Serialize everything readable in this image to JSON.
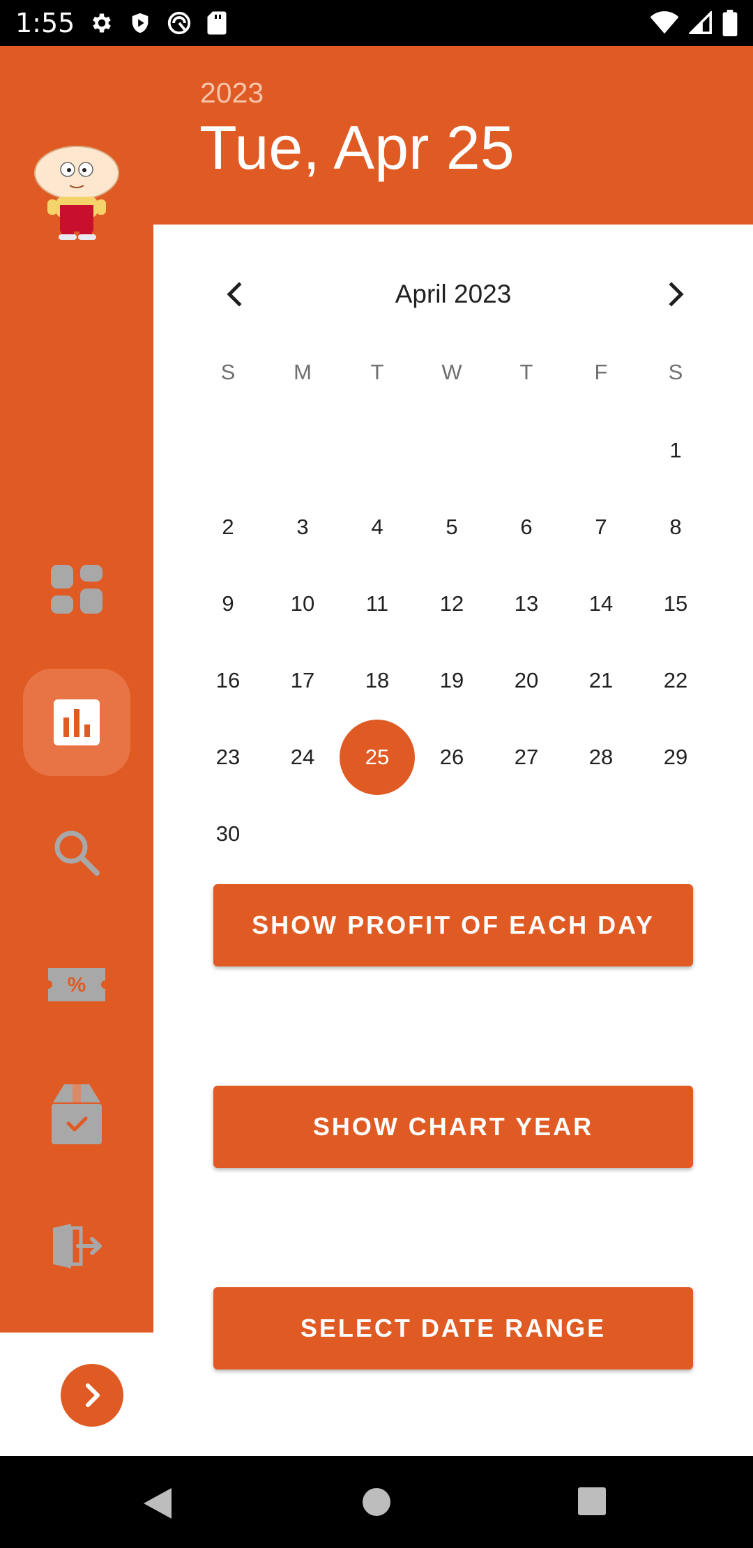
{
  "status_bar": {
    "time": "1:55",
    "left_icons": [
      "settings-icon",
      "shield-play-icon",
      "vpn-icon",
      "sd-card-icon"
    ],
    "right_icons": [
      "wifi-icon",
      "signal-icon",
      "battery-icon"
    ]
  },
  "header": {
    "year": "2023",
    "date": "Tue, Apr 25"
  },
  "sidebar": {
    "items": [
      {
        "name": "dashboard",
        "icon": "dashboard-icon"
      },
      {
        "name": "statistics",
        "icon": "bar-chart-icon",
        "active": true
      },
      {
        "name": "search",
        "icon": "search-icon"
      },
      {
        "name": "coupons",
        "icon": "coupon-percent-icon"
      },
      {
        "name": "orders",
        "icon": "box-check-icon"
      },
      {
        "name": "logout",
        "icon": "logout-icon"
      }
    ],
    "expand_icon": "chevron-right-icon"
  },
  "calendar": {
    "month_label": "April 2023",
    "weekdays": [
      "S",
      "M",
      "T",
      "W",
      "T",
      "F",
      "S"
    ],
    "days": [
      "1",
      "2",
      "3",
      "4",
      "5",
      "6",
      "7",
      "8",
      "9",
      "10",
      "11",
      "12",
      "13",
      "14",
      "15",
      "16",
      "17",
      "18",
      "19",
      "20",
      "21",
      "22",
      "23",
      "24",
      "25",
      "26",
      "27",
      "28",
      "29",
      "30"
    ],
    "selected_day": "25",
    "first_weekday_index": 6
  },
  "buttons": {
    "profit_each_day": "SHOW PROFIT OF EACH DAY",
    "chart_year": "SHOW CHART YEAR",
    "date_range": "SELECT DATE RANGE"
  },
  "colors": {
    "accent": "#e05a24",
    "active_item": "#e87446",
    "inactive_icon": "#a8a8a8"
  }
}
